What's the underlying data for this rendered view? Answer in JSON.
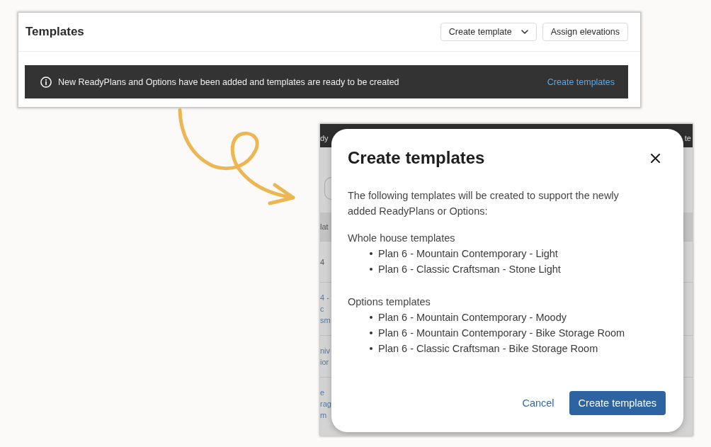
{
  "header_card": {
    "title": "Templates",
    "buttons": [
      {
        "label": "Create template",
        "kind": "dropdown"
      },
      {
        "label": "Assign elevations",
        "kind": "plain"
      }
    ],
    "banner": {
      "message": "New ReadyPlans and Options have been added and templates are ready to be created",
      "link": "Create templates"
    }
  },
  "background_screen": {
    "top_bar": {
      "left_fragment": "dy",
      "right_fragment": "te"
    },
    "table": {
      "header_fragment": "lat",
      "rows": [
        {
          "kind": "plain",
          "lines": [
            "4"
          ]
        },
        {
          "kind": "link",
          "lines": [
            "4 -",
            "c",
            "sm"
          ]
        },
        {
          "kind": "link",
          "lines": [
            "niv",
            "ior"
          ]
        },
        {
          "kind": "link",
          "lines": [
            "e",
            "rag",
            "m"
          ]
        }
      ]
    }
  },
  "modal": {
    "title": "Create templates",
    "intro": "The following templates will be created to support the newly added ReadyPlans or Options:",
    "sections": [
      {
        "heading": "Whole house templates",
        "items": [
          "Plan 6 - Mountain Contemporary - Light",
          "Plan 6 - Classic Craftsman - Stone Light"
        ]
      },
      {
        "heading": "Options templates",
        "items": [
          "Plan 6 - Mountain Contemporary - Moody",
          "Plan 6 - Mountain Contemporary - Bike Storage Room",
          "Plan 6 - Classic Craftsman - Bike Storage Room"
        ]
      }
    ],
    "actions": [
      {
        "label": "Cancel",
        "kind": "link"
      },
      {
        "label": "Create templates",
        "kind": "primary"
      }
    ]
  }
}
